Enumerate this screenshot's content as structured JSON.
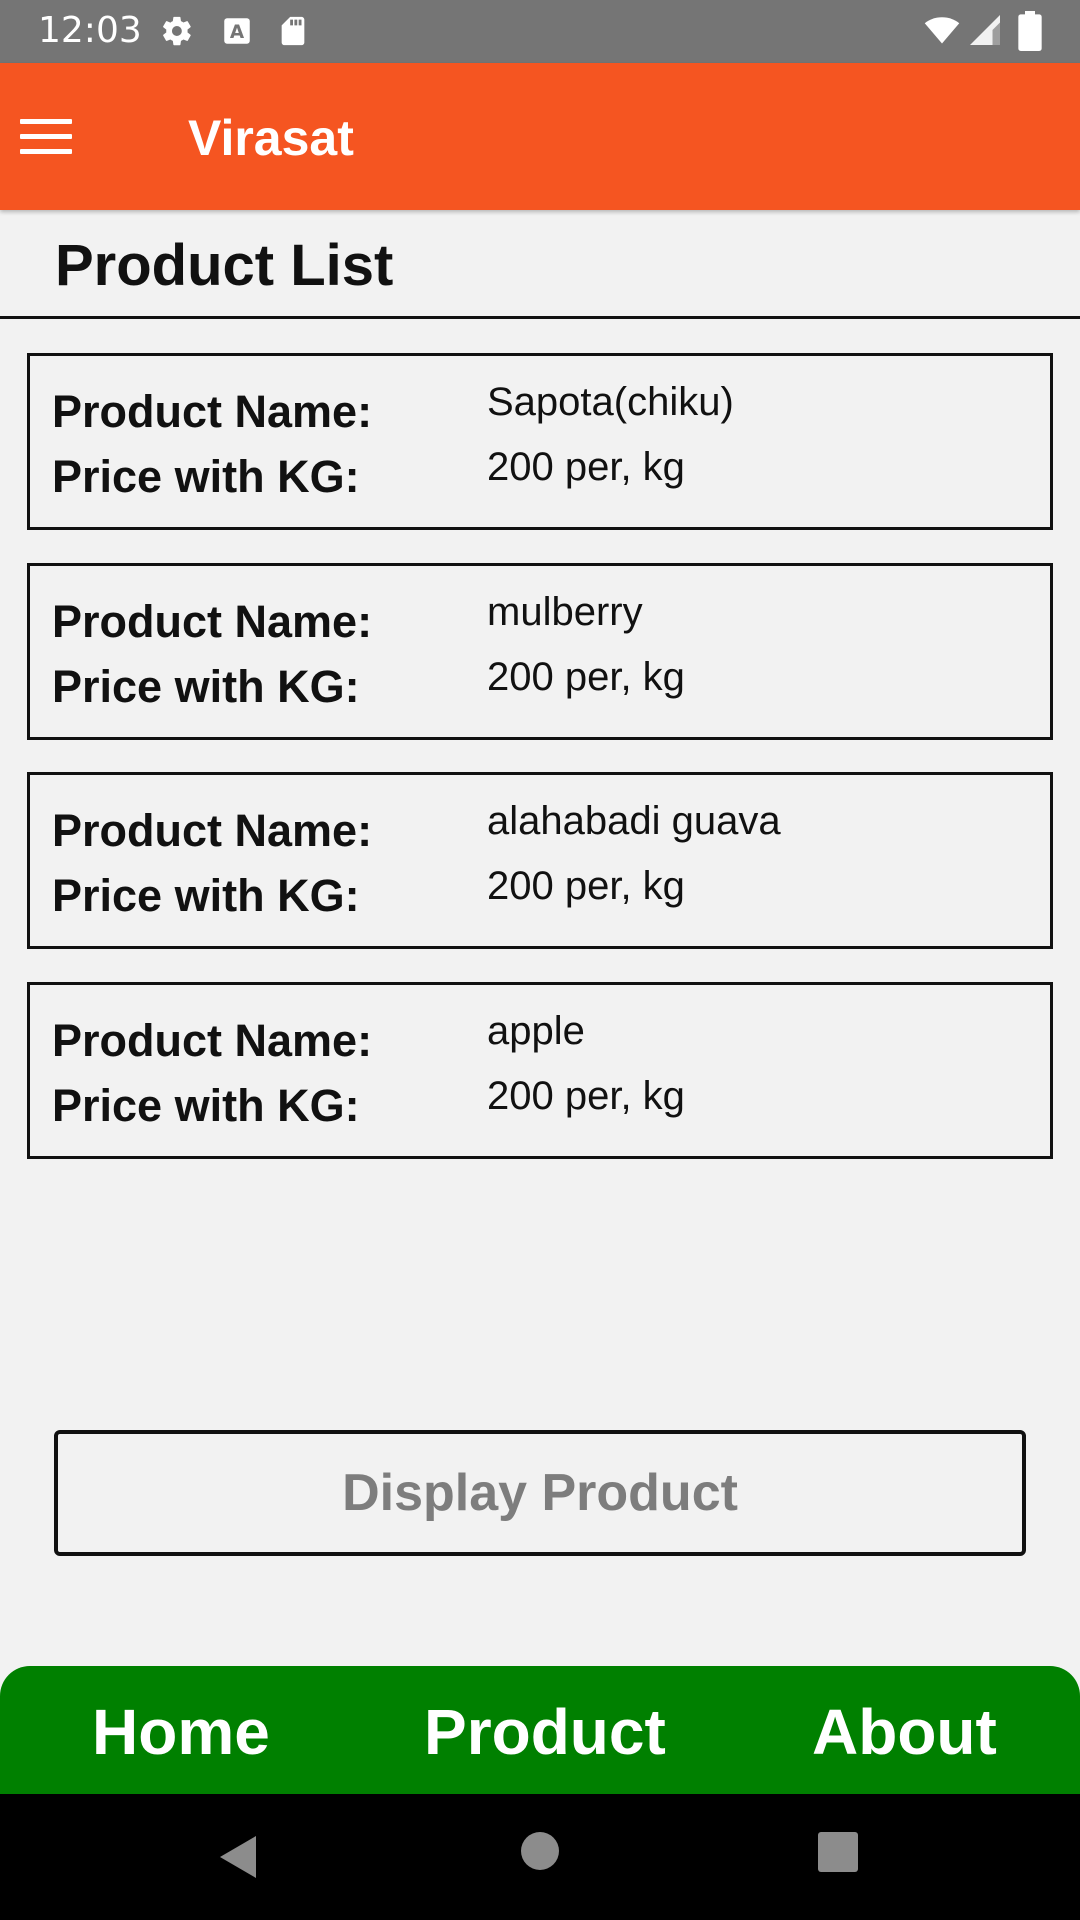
{
  "status_bar": {
    "time": "12:03",
    "icons": [
      "settings-icon",
      "a-notification-icon",
      "sd-card-icon",
      "wifi-icon",
      "signal-icon",
      "battery-icon"
    ]
  },
  "app_bar": {
    "title": "Virasat",
    "background": "#f55521"
  },
  "page": {
    "title": "Product List"
  },
  "products": [
    {
      "name_label": "Product Name:",
      "name": "Sapota(chiku)",
      "price_label": "Price with KG:",
      "price": "200 per, kg"
    },
    {
      "name_label": "Product Name:",
      "name": "mulberry",
      "price_label": "Price with KG:",
      "price": "200 per, kg"
    },
    {
      "name_label": "Product Name:",
      "name": "alahabadi guava",
      "price_label": "Price with KG:",
      "price": "200 per, kg"
    },
    {
      "name_label": "Product Name:",
      "name": "apple",
      "price_label": "Price with KG:",
      "price": "200 per, kg"
    }
  ],
  "display_button": {
    "label": "Display Product"
  },
  "bottom_nav": {
    "background": "#008000",
    "items": [
      {
        "label": "Home"
      },
      {
        "label": "Product"
      },
      {
        "label": "About"
      }
    ]
  },
  "system_nav": {
    "icons": [
      "back-icon",
      "home-circle-icon",
      "recents-icon"
    ]
  }
}
